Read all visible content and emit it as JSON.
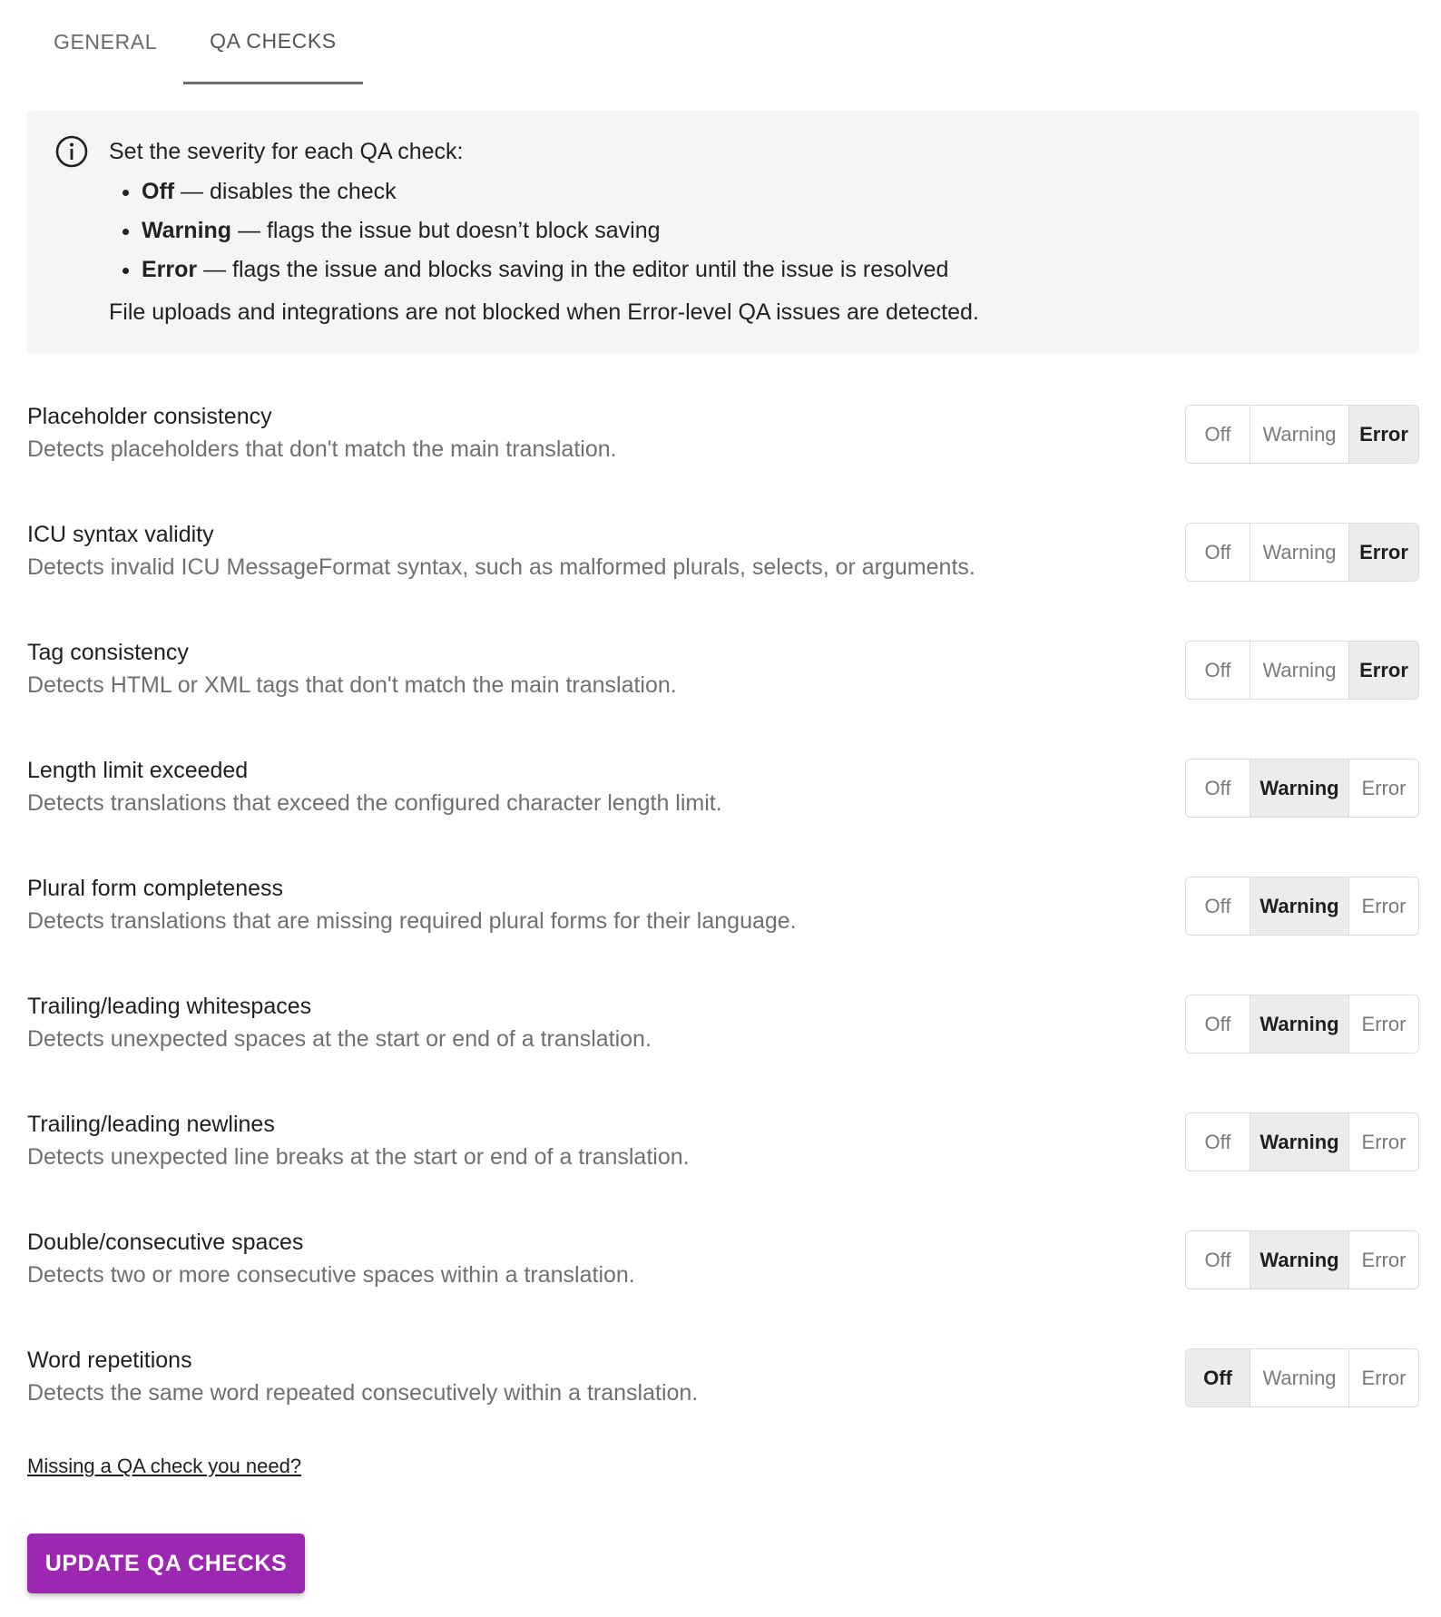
{
  "tabs": [
    {
      "label": "GENERAL",
      "active": false
    },
    {
      "label": "QA CHECKS",
      "active": true
    }
  ],
  "info": {
    "icon": "info-icon",
    "intro": "Set the severity for each QA check:",
    "bullets": [
      {
        "term": "Off",
        "text": " — disables the check"
      },
      {
        "term": "Warning",
        "text": " — flags the issue but doesn’t block saving"
      },
      {
        "term": "Error",
        "text": " — flags the issue and blocks saving in the editor until the issue is resolved"
      }
    ],
    "note": "File uploads and integrations are not blocked when Error-level QA issues are detected."
  },
  "severity_options": [
    "Off",
    "Warning",
    "Error"
  ],
  "checks": [
    {
      "title": "Placeholder consistency",
      "description": "Detects placeholders that don't match the main translation.",
      "selected": "Error"
    },
    {
      "title": "ICU syntax validity",
      "description": "Detects invalid ICU MessageFormat syntax, such as malformed plurals, selects, or arguments.",
      "selected": "Error"
    },
    {
      "title": "Tag consistency",
      "description": "Detects HTML or XML tags that don't match the main translation.",
      "selected": "Error"
    },
    {
      "title": "Length limit exceeded",
      "description": "Detects translations that exceed the configured character length limit.",
      "selected": "Warning"
    },
    {
      "title": "Plural form completeness",
      "description": "Detects translations that are missing required plural forms for their language.",
      "selected": "Warning"
    },
    {
      "title": "Trailing/leading whitespaces",
      "description": "Detects unexpected spaces at the start or end of a translation.",
      "selected": "Warning"
    },
    {
      "title": "Trailing/leading newlines",
      "description": "Detects unexpected line breaks at the start or end of a translation.",
      "selected": "Warning"
    },
    {
      "title": "Double/consecutive spaces",
      "description": "Detects two or more consecutive spaces within a translation.",
      "selected": "Warning"
    },
    {
      "title": "Word repetitions",
      "description": "Detects the same word repeated consecutively within a translation.",
      "selected": "Off"
    }
  ],
  "missing_link": "Missing a QA check you need?",
  "update_button": "UPDATE QA CHECKS",
  "colors": {
    "accent": "#9c27b0",
    "selected_bg": "#ececec",
    "info_bg": "#f5f5f5"
  }
}
